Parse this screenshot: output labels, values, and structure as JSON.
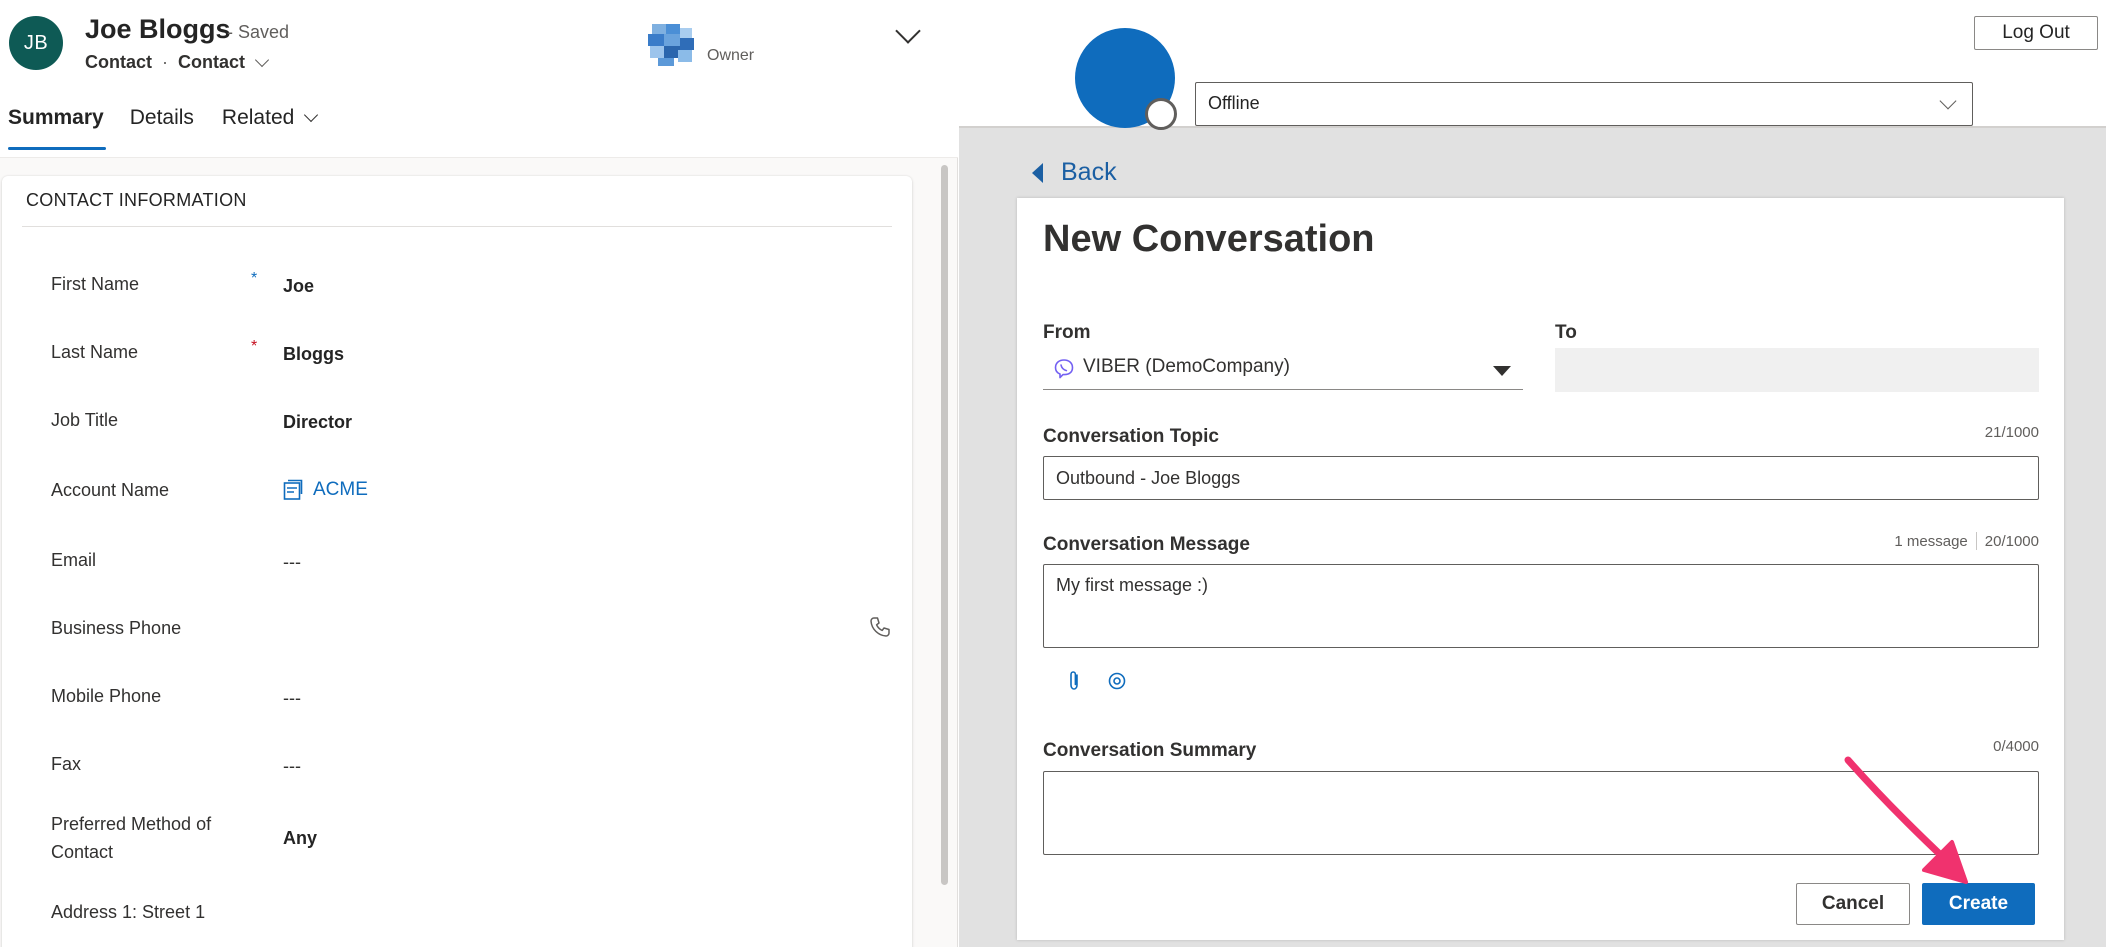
{
  "record": {
    "initials": "JB",
    "name": "Joe Bloggs",
    "saved_status": "- Saved",
    "entity": "Contact",
    "separator": "·",
    "form": "Contact",
    "owner_label": "Owner"
  },
  "tabs": [
    {
      "label": "Summary",
      "active": true
    },
    {
      "label": "Details",
      "active": false
    },
    {
      "label": "Related",
      "active": false
    }
  ],
  "contact_section": {
    "title": "CONTACT INFORMATION",
    "fields": [
      {
        "label": "First Name",
        "value": "Joe",
        "required": "*"
      },
      {
        "label": "Last Name",
        "value": "Bloggs",
        "required": "*"
      },
      {
        "label": "Job Title",
        "value": "Director"
      },
      {
        "label": "Account Name",
        "value": "ACME"
      },
      {
        "label": "Email",
        "value": "---"
      },
      {
        "label": "Business Phone",
        "value": ""
      },
      {
        "label": "Mobile Phone",
        "value": "---"
      },
      {
        "label": "Fax",
        "value": "---"
      },
      {
        "label": "Preferred Method of Contact",
        "value": "Any"
      },
      {
        "label": "Address 1: Street 1",
        "value": ""
      }
    ]
  },
  "agent": {
    "status": "Offline",
    "logout_label": "Log Out"
  },
  "back_label": "Back",
  "conversation": {
    "title": "New Conversation",
    "from_label": "From",
    "from_value": "VIBER (DemoCompany)",
    "to_label": "To",
    "to_value": "",
    "topic_label": "Conversation Topic",
    "topic_counter": "21/1000",
    "topic_value": "Outbound - Joe Bloggs",
    "message_label": "Conversation Message",
    "message_count": "1 message",
    "message_counter": "20/1000",
    "message_value": "My first message :)",
    "summary_label": "Conversation Summary",
    "summary_counter": "0/4000",
    "summary_value": "",
    "cancel_label": "Cancel",
    "create_label": "Create"
  },
  "icons": {
    "phone": "phone-icon",
    "account": "account-icon",
    "attach": "paperclip-icon",
    "emoji": "target-icon",
    "viber": "viber-icon"
  },
  "colors": {
    "accent": "#0f6cbd",
    "avatar_bg": "#0e5a55",
    "required": "#c50f1f",
    "pointer_arrow": "#f0326e"
  }
}
